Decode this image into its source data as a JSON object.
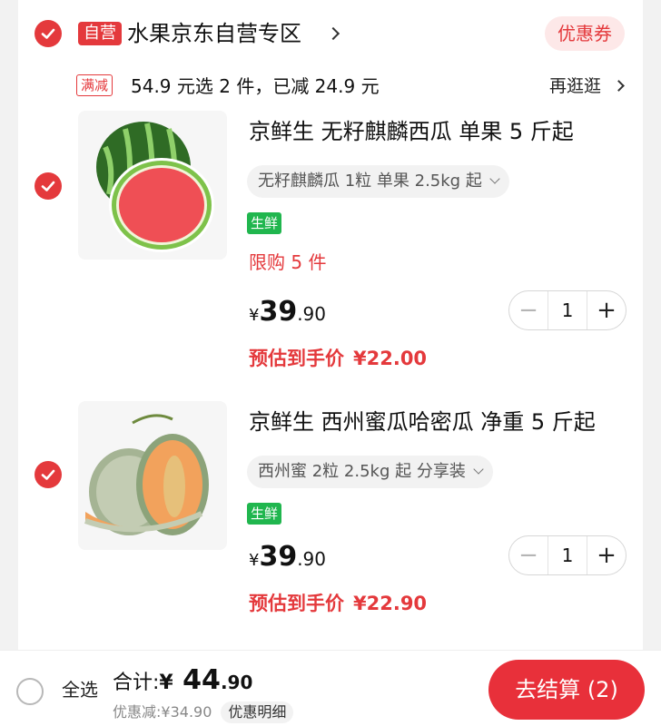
{
  "store": {
    "badge": "自营",
    "name": "水果京东自营专区",
    "coupon_label": "优惠券"
  },
  "promo": {
    "tag": "满减",
    "text": "54.9 元选 2 件，已减 24.9 元",
    "more_label": "再逛逛"
  },
  "products": [
    {
      "title": "京鲜生 无籽麒麟西瓜   单果 5 斤起",
      "sku": "无籽麒麟瓜 1粒 单果 2.5kg 起",
      "tag": "生鲜",
      "limit": "限购 5 件",
      "price_symbol": "¥",
      "price_int": "39",
      "price_dec": ".90",
      "est_label": "预估到手价",
      "est_value": "¥22.00",
      "quantity": "1",
      "image_icon": "watermelon-image"
    },
    {
      "title": "京鲜生 西州蜜瓜哈密瓜  净重 5 斤起",
      "sku": "西州蜜 2粒 2.5kg 起 分享装",
      "tag": "生鲜",
      "price_symbol": "¥",
      "price_int": "39",
      "price_dec": ".90",
      "est_label": "预估到手价",
      "est_value": "¥22.90",
      "quantity": "1",
      "image_icon": "cantaloupe-image"
    }
  ],
  "stepper": {
    "minus": "−",
    "plus": "+"
  },
  "footer": {
    "select_all": "全选",
    "total_label": "合计:",
    "total_symbol": "¥",
    "total_int": " 44",
    "total_dec": ".90",
    "discount_label": "优惠减:",
    "discount_value": "¥34.90",
    "detail_label": "优惠明细",
    "checkout_label": "去结算 (2)"
  },
  "colors": {
    "accent": "#e4393c",
    "fresh_tag": "#20b64e",
    "checkout": "#e8303a"
  }
}
